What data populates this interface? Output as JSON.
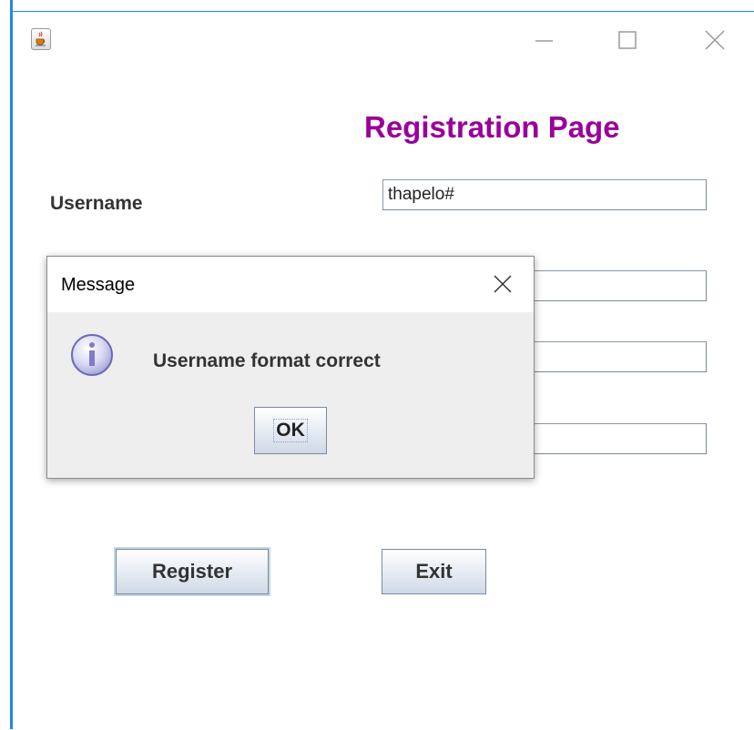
{
  "window": {
    "title_icon": "java-coffee-cup-icon",
    "controls": [
      "minimize-icon",
      "maximize-icon",
      "close-icon"
    ]
  },
  "form": {
    "heading": "Registration Page",
    "username_label": "Username",
    "username_value": "thapelo#",
    "field2_value": "",
    "field3_value": "",
    "field4_value": "",
    "register_label": "Register",
    "exit_label": "Exit"
  },
  "dialog": {
    "title": "Message",
    "message": "Username format correct",
    "ok_label": "OK",
    "icon": "information-icon"
  },
  "colors": {
    "heading": "#990099",
    "accent": "#1e88e5"
  }
}
